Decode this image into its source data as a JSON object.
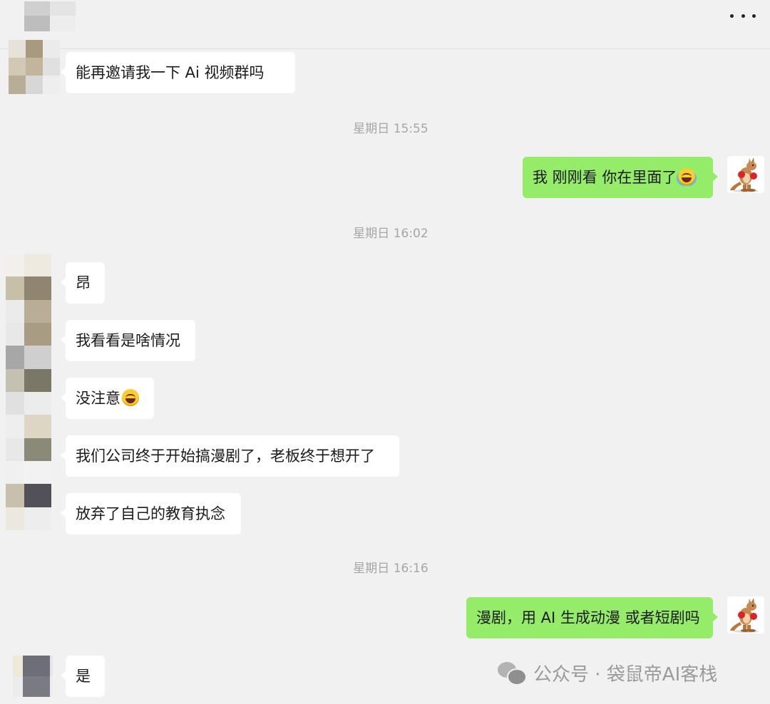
{
  "header": {
    "more_icon": "more-horizontal-icon"
  },
  "messages": [
    {
      "side": "left",
      "text": "能再邀请我一下 Ai 视频群吗"
    },
    {
      "timestamp": "星期日 15:55"
    },
    {
      "side": "right",
      "text": "我 刚刚看 你在里面了",
      "emoji": "face-with-tears-of-joy"
    },
    {
      "timestamp": "星期日 16:02"
    },
    {
      "side": "left",
      "text": "昂"
    },
    {
      "side": "left",
      "text": "我看看是啥情况"
    },
    {
      "side": "left",
      "text": "没注意",
      "emoji": "grinning-squinting-face"
    },
    {
      "side": "left",
      "text": "我们公司终于开始搞漫剧了，老板终于想开了"
    },
    {
      "side": "left",
      "text": "放弃了自己的教育执念"
    },
    {
      "timestamp": "星期日 16:16"
    },
    {
      "side": "right",
      "text": "漫剧，用 AI 生成动漫 或者短剧吗"
    },
    {
      "side": "left",
      "text": "是"
    }
  ],
  "my_avatar": "kangaroo-boxer-avatar",
  "watermark": {
    "icon": "wechat-icon",
    "text": "公众号 · 袋鼠帝AI客栈"
  },
  "colors": {
    "background": "#f1f1f1",
    "incoming_bubble": "#ffffff",
    "outgoing_bubble": "#95ec69",
    "timestamp": "#a6a6a6"
  }
}
